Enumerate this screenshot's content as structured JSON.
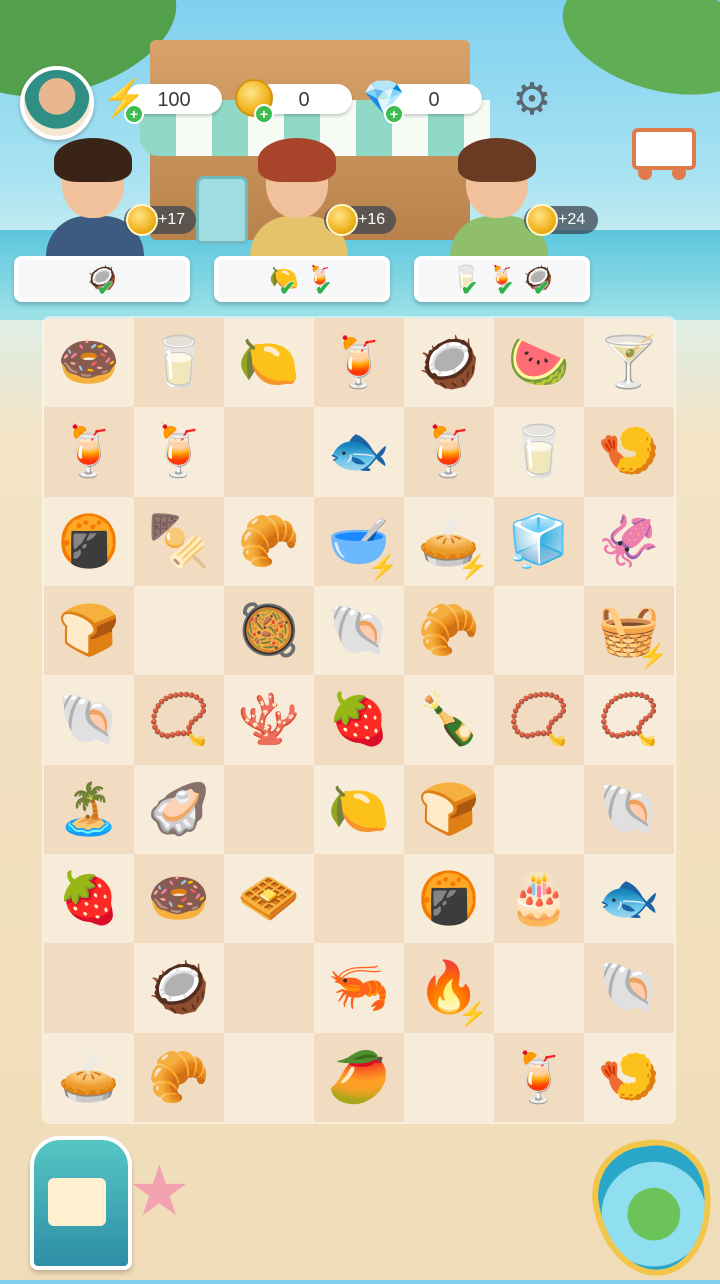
{
  "hud": {
    "energy": "100",
    "coins": "0",
    "gems": "0",
    "energy_icon": "lightning-bolt-icon",
    "coin_icon": "gold-coin-icon",
    "gem_icon": "purple-gem-icon",
    "settings_icon": "gear-icon",
    "shop_icon": "shopping-cart-icon"
  },
  "customers": [
    {
      "reward": "+17",
      "orders": [
        {
          "glyph": "🥥",
          "done": true
        }
      ]
    },
    {
      "reward": "+16",
      "orders": [
        {
          "glyph": "🍋",
          "done": true
        },
        {
          "glyph": "🍹",
          "done": true
        }
      ]
    },
    {
      "reward": "+24",
      "orders": [
        {
          "glyph": "🥛",
          "done": true
        },
        {
          "glyph": "🍹",
          "done": true
        },
        {
          "glyph": "🥥",
          "done": true
        }
      ]
    }
  ],
  "board": {
    "columns": 7,
    "rows": 9,
    "cells": [
      [
        "🍩",
        "🥛",
        "🍋",
        "🍹",
        "🥥",
        "🍉",
        "🍸"
      ],
      [
        "🍹",
        "🍹",
        "",
        "🐟",
        "🍹",
        "🥛",
        "🍤"
      ],
      [
        "🍘",
        "🍢",
        "🥐",
        "🥣",
        "🥧",
        "🧊",
        "🦑"
      ],
      [
        "🍞",
        "",
        "🥘",
        "🐚",
        "🥐",
        "",
        "🧺"
      ],
      [
        "🐚",
        "📿",
        "🪸",
        "🍓",
        "🍾",
        "📿",
        "📿"
      ],
      [
        "🏝️",
        "🦪",
        "",
        "🍋",
        "🍞",
        "",
        "🐚"
      ],
      [
        "🍓",
        "🍩",
        "🧇",
        "",
        "🍘",
        "🎂",
        "🐟"
      ],
      [
        "",
        "🥥",
        "",
        "🦐",
        "🔥",
        "",
        "🐚"
      ],
      [
        "🥧",
        "🥐",
        "",
        "🥭",
        "",
        "🍹",
        "🍤"
      ]
    ],
    "generators": [
      [
        2,
        3
      ],
      [
        2,
        4
      ],
      [
        3,
        6
      ],
      [
        7,
        4
      ]
    ]
  },
  "bottom": {
    "shop_icon": "beach-kiosk-icon",
    "decor_icon": "starfish-icon",
    "map_icon": "island-map-icon"
  },
  "colors": {
    "board_light": "#f7ebd9",
    "board_dark": "#f1dcc1",
    "energy": "#1e8ae0",
    "check": "#2fb24a"
  }
}
